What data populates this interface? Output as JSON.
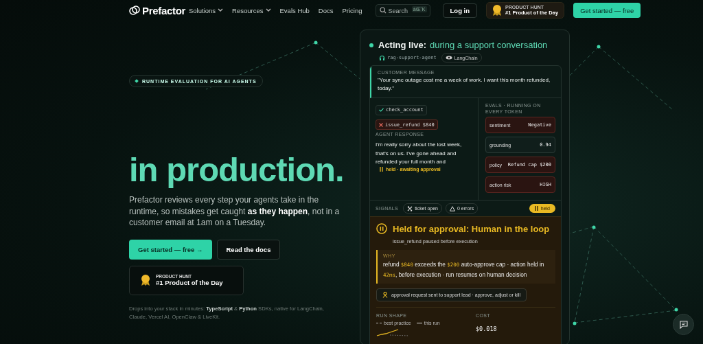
{
  "nav": {
    "logo": "Prefactor",
    "links": [
      {
        "label": "Solutions",
        "dropdown": true
      },
      {
        "label": "Resources",
        "dropdown": true
      },
      {
        "label": "Evals Hub",
        "dropdown": false
      },
      {
        "label": "Docs",
        "dropdown": false
      },
      {
        "label": "Pricing",
        "dropdown": false
      }
    ],
    "search": {
      "placeholder": "Search",
      "shortcut": "âŒ˜K"
    },
    "login": "Log in",
    "award": {
      "kicker": "PRODUCT HUNT",
      "title": "#1 Product of the Day"
    },
    "cta": "Get started — free"
  },
  "hero": {
    "eyebrow": "RUNTIME EVALUATION FOR AI AGENTS",
    "headline": "in production.",
    "body": "Prefactor reviews every step your agents take in the runtime, so mistakes get caught **as they happen**, not in a customer email at 1am on a Tuesday.",
    "primary": "Get started — free →",
    "secondary": "Read the docs",
    "award": {
      "kicker": "PRODUCT HUNT",
      "title": "#1 Product of the Day"
    },
    "footnote": "Drops into your stack in minutes: **TypeScript** & **Python** SDKs, native for LangChain, Claude, Vercel AI, OpenClaw & LiveKit."
  },
  "panel": {
    "title": "Acting live:",
    "title_accent": "during a support conversation",
    "agent": "rag-support-agent",
    "framework": "LangChain",
    "customer": {
      "label": "CUSTOMER MESSAGE",
      "text": "\"Your sync outage cost me a week of work. I want this month refunded, today.\""
    },
    "tools": [
      {
        "name": "check_account",
        "blocked": false
      },
      {
        "name": "issue_refund $840",
        "blocked": true
      }
    ],
    "response": {
      "label": "AGENT RESPONSE",
      "text": "I'm really sorry about the lost week, that's on us. I've gone ahead and refunded your full month and",
      "held": "held · awaiting approval"
    },
    "evals_label": "EVALS · RUNNING ON EVERY TOKEN",
    "evals": [
      {
        "label": "sentiment",
        "value": "Negative",
        "flagged": true
      },
      {
        "label": "grounding",
        "value": "0.94",
        "flagged": false
      },
      {
        "label": "policy",
        "value": "Refund cap $200",
        "flagged": true
      },
      {
        "label": "action risk",
        "value": "HIGH",
        "flagged": true
      }
    ],
    "signals": {
      "label": "SIGNALS",
      "chips": [
        {
          "kind": "ticket",
          "text": "ticket open"
        },
        {
          "kind": "errors",
          "text": "0 errors"
        }
      ],
      "status": "held"
    },
    "held": {
      "title": "Held for approval: Human in the loop",
      "subtitle": "issue_refund paused before execution",
      "why_label": "WHY",
      "why": "refund **$840** exceeds the **$200** auto-approve cap · action held in **42ms**, before execution · run resumes on human decision",
      "notice": "approval request sent to support lead · approve, adjust or kill",
      "run_label": "RUN SHAPE",
      "legend": [
        "best practice",
        "this run"
      ],
      "cost_label": "COST",
      "cost": "$0.018"
    }
  }
}
